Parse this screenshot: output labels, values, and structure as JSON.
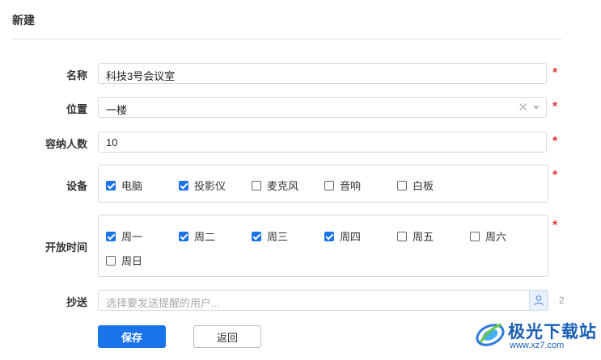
{
  "page": {
    "title": "新建"
  },
  "form": {
    "name": {
      "label": "名称",
      "value": "科技3号会议室",
      "required": "*"
    },
    "location": {
      "label": "位置",
      "value": "一楼",
      "clear_glyph": "✕",
      "required": "*"
    },
    "capacity": {
      "label": "容纳人数",
      "value": "10",
      "required": "*"
    },
    "equipment": {
      "label": "设备",
      "required": "*",
      "options": [
        {
          "label": "电脑",
          "checked": true
        },
        {
          "label": "投影仪",
          "checked": true
        },
        {
          "label": "麦克风",
          "checked": false
        },
        {
          "label": "音响",
          "checked": false
        },
        {
          "label": "白板",
          "checked": false
        }
      ]
    },
    "open_time": {
      "label": "开放时间",
      "required": "*",
      "options": [
        {
          "label": "周一",
          "checked": true
        },
        {
          "label": "周二",
          "checked": true
        },
        {
          "label": "周三",
          "checked": true
        },
        {
          "label": "周四",
          "checked": true
        },
        {
          "label": "周五",
          "checked": false
        },
        {
          "label": "周六",
          "checked": false
        },
        {
          "label": "周日",
          "checked": false
        }
      ]
    },
    "cc": {
      "label": "抄送",
      "placeholder": "选择要发送提醒的用户...",
      "icon": "user-icon",
      "side_mark": "2"
    }
  },
  "buttons": {
    "save": "保存",
    "back": "返回"
  },
  "watermark": {
    "name": "极光下载站",
    "url": "www.xz7.com"
  },
  "colors": {
    "accent": "#1a73e8",
    "required": "#e4393c",
    "border": "#d9d9d9"
  }
}
